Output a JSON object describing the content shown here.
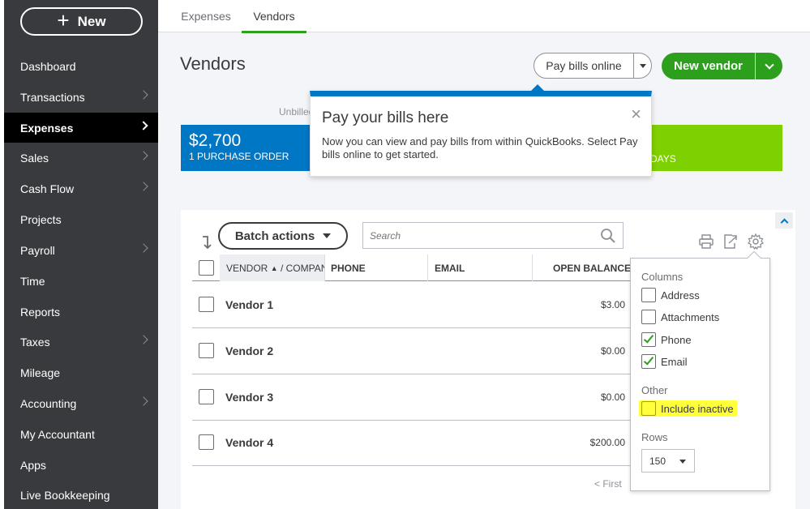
{
  "sidebar": {
    "new_label": "New",
    "items": [
      {
        "label": "Dashboard",
        "chevron": false
      },
      {
        "label": "Transactions",
        "chevron": true
      },
      {
        "label": "Expenses",
        "chevron": true,
        "active": true
      },
      {
        "label": "Sales",
        "chevron": true
      },
      {
        "label": "Cash Flow",
        "chevron": true
      },
      {
        "label": "Projects",
        "chevron": false
      },
      {
        "label": "Payroll",
        "chevron": true
      },
      {
        "label": "Time",
        "chevron": false
      },
      {
        "label": "Reports",
        "chevron": false
      },
      {
        "label": "Taxes",
        "chevron": true
      },
      {
        "label": "Mileage",
        "chevron": false
      },
      {
        "label": "Accounting",
        "chevron": true
      },
      {
        "label": "My Accountant",
        "chevron": false
      },
      {
        "label": "Apps",
        "chevron": false
      },
      {
        "label": "Live Bookkeeping",
        "chevron": false
      }
    ]
  },
  "tabs": [
    {
      "label": "Expenses",
      "active": false
    },
    {
      "label": "Vendors",
      "active": true
    }
  ],
  "header": {
    "title": "Vendors",
    "pay_bills_label": "Pay bills online",
    "new_vendor_label": "New vendor"
  },
  "summary": {
    "unbilled_label": "Unbilled",
    "blue_amount": "$2,700",
    "blue_sub": "1 PURCHASE ORDER",
    "green_sub": "DAYS"
  },
  "popover": {
    "title": "Pay your bills here",
    "body": "Now you can view and pay bills from within QuickBooks. Select Pay bills online to get started.",
    "close": "×"
  },
  "toolbar": {
    "batch_label": "Batch actions",
    "search_placeholder": "Search"
  },
  "table": {
    "columns": {
      "vendor": "VENDOR",
      "sort_indicator": "▲",
      "company": "/ COMPANY",
      "phone": "PHONE",
      "email": "EMAIL",
      "balance": "OPEN BALANCE"
    },
    "rows": [
      {
        "name": "Vendor 1",
        "balance": "$3.00"
      },
      {
        "name": "Vendor 2",
        "balance": "$0.00"
      },
      {
        "name": "Vendor 3",
        "balance": "$0.00"
      },
      {
        "name": "Vendor 4",
        "balance": "$200.00"
      }
    ],
    "pager": "< First"
  },
  "settings": {
    "columns_heading": "Columns",
    "column_options": [
      {
        "label": "Address",
        "checked": false
      },
      {
        "label": "Attachments",
        "checked": false
      },
      {
        "label": "Phone",
        "checked": true
      },
      {
        "label": "Email",
        "checked": true
      }
    ],
    "other_heading": "Other",
    "include_inactive_label": "Include inactive",
    "include_inactive_checked": false,
    "rows_heading": "Rows",
    "rows_value": "150"
  },
  "colors": {
    "sidebar_bg": "#393a3d",
    "active_nav_bg": "#000000",
    "brand_green": "#2ca01c",
    "card_blue": "#0077c5",
    "card_green": "#7fd000",
    "highlight_yellow": "#ffff3b"
  },
  "icons": [
    "plus-icon",
    "chevron-right-icon",
    "chevron-down-icon",
    "close-icon",
    "sort-arrow-icon",
    "search-icon",
    "print-icon",
    "export-icon",
    "gear-icon",
    "checkmark-icon",
    "chevron-up-icon"
  ]
}
